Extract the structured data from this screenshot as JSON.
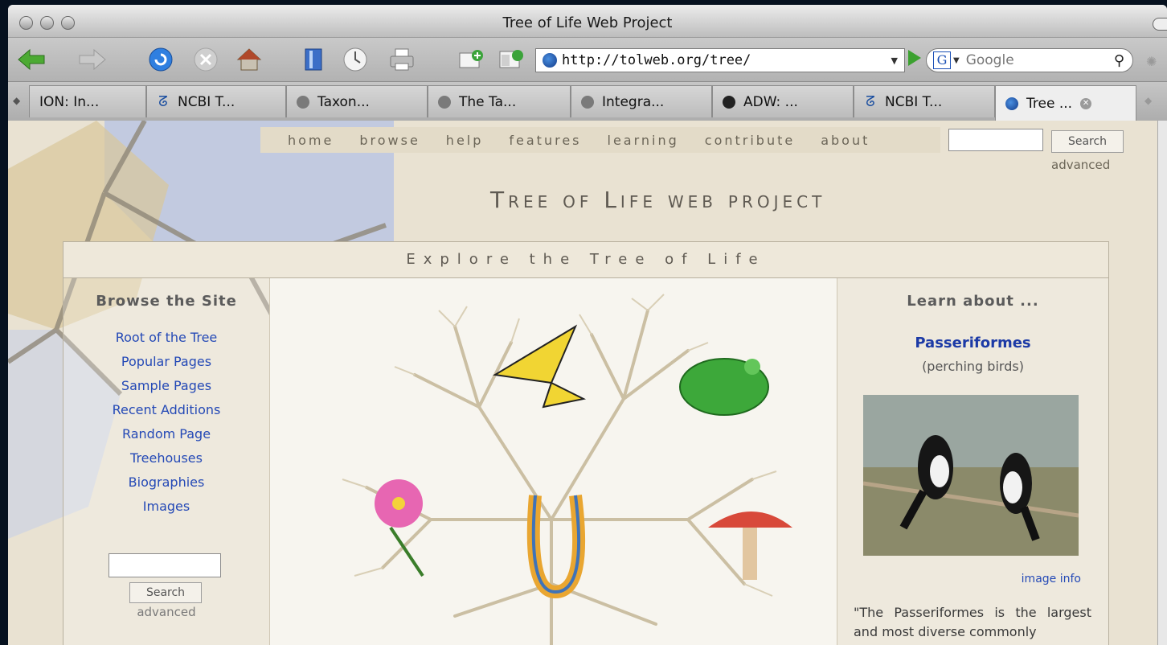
{
  "window": {
    "title": "Tree of Life Web Project"
  },
  "toolbar": {
    "url": "http://tolweb.org/tree/",
    "search_placeholder": "Google"
  },
  "tabs": [
    {
      "label": "ION: In..."
    },
    {
      "label": "NCBI T..."
    },
    {
      "label": "Taxon..."
    },
    {
      "label": "The Ta..."
    },
    {
      "label": "Integra..."
    },
    {
      "label": "ADW: ..."
    },
    {
      "label": "NCBI T..."
    },
    {
      "label": "Tree ..."
    }
  ],
  "site": {
    "nav": [
      "home",
      "browse",
      "help",
      "features",
      "learning",
      "contribute",
      "about"
    ],
    "search_button": "Search",
    "advanced": "advanced",
    "brand": "Tree of Life web project",
    "explore": "Explore the Tree of Life",
    "browse": {
      "heading": "Browse the Site",
      "links": [
        "Root of the Tree",
        "Popular Pages",
        "Sample Pages",
        "Recent Additions",
        "Random Page",
        "Treehouses",
        "Biographies",
        "Images"
      ],
      "search_button": "Search",
      "advanced": "advanced"
    },
    "learn": {
      "heading": "Learn about ...",
      "title": "Passeriformes",
      "subtitle": "(perching birds)",
      "image_info": "image info",
      "quote": "\"The Passeriformes is the largest and most diverse commonly"
    }
  }
}
